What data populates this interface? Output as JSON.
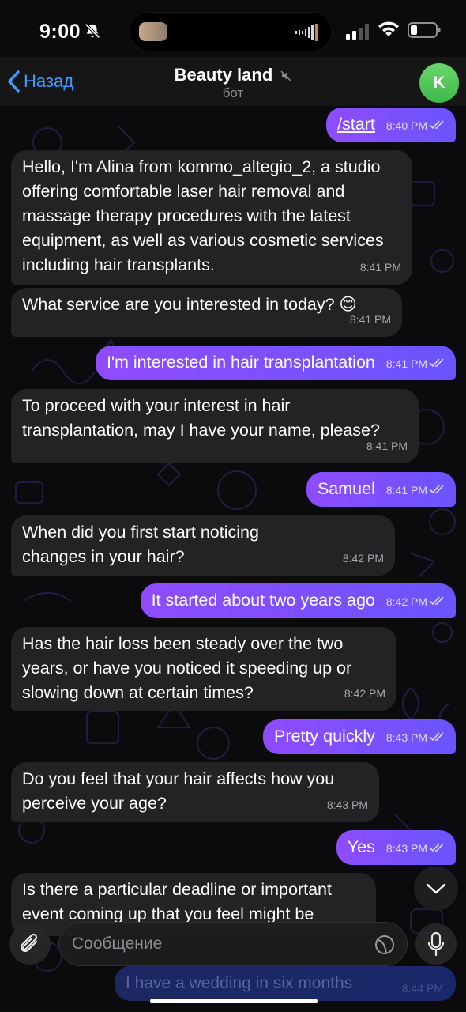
{
  "status": {
    "time": "9:00"
  },
  "header": {
    "back_label": "Назад",
    "title": "Beauty land",
    "subtitle": "бот",
    "avatar_letter": "K"
  },
  "messages": [
    {
      "dir": "out",
      "text": "/start",
      "time": "8:40 PM"
    },
    {
      "dir": "in",
      "text": "Hello, I'm Alina from kommo_altegio_2, a studio offering comfortable laser hair removal and massage therapy procedures with the latest equipment, as well as various cosmetic services including hair transplants.",
      "time": "8:41 PM"
    },
    {
      "dir": "in",
      "text": "What service are you interested in today? 😊",
      "time": "8:41 PM"
    },
    {
      "dir": "out",
      "text": "I'm interested in hair transplantation",
      "time": "8:41 PM"
    },
    {
      "dir": "in",
      "text": "To proceed with your interest in hair transplantation, may I have your name, please?",
      "time": "8:41 PM"
    },
    {
      "dir": "out",
      "text": "Samuel",
      "time": "8:41 PM"
    },
    {
      "dir": "in",
      "text": "When did you first start noticing changes in your hair?",
      "time": "8:42 PM"
    },
    {
      "dir": "out",
      "text": "It started about two years ago",
      "time": "8:42 PM"
    },
    {
      "dir": "in",
      "text": "Has the hair loss been steady over the two years, or have you noticed it speeding up or slowing down at certain times?",
      "time": "8:42 PM"
    },
    {
      "dir": "out",
      "text": "Pretty quickly",
      "time": "8:43 PM"
    },
    {
      "dir": "in",
      "text": "Do you feel that your hair affects how you perceive your age?",
      "time": "8:43 PM"
    },
    {
      "dir": "out",
      "text": "Yes",
      "time": "8:43 PM"
    },
    {
      "dir": "in",
      "text": "Is there a particular deadline or important event coming up that you feel might be",
      "time": ""
    },
    {
      "dir": "out",
      "text": "I have a wedding in six months",
      "time": "8:44 PM"
    }
  ],
  "input": {
    "placeholder": "Сообщение"
  },
  "colors": {
    "accent": "#3e9bff",
    "outgoing": "#7a50ff",
    "incoming": "#232225",
    "avatar": "#4cc154"
  }
}
